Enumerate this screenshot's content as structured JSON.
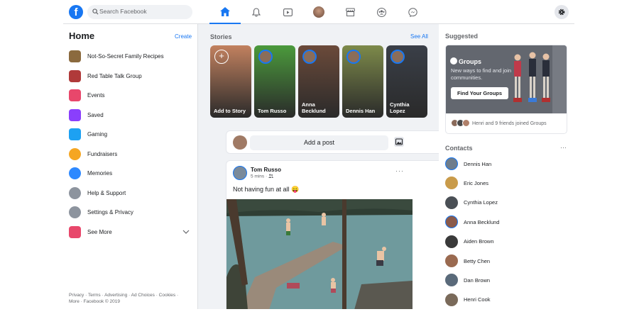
{
  "search": {
    "placeholder": "Search Facebook"
  },
  "nav": [
    "home-icon",
    "bell-icon",
    "video-icon",
    "profile-avatar",
    "marketplace-icon",
    "groups-icon",
    "messenger-icon"
  ],
  "left": {
    "title": "Home",
    "create": "Create",
    "items": [
      {
        "label": "Not-So-Secret Family Recipes",
        "icon": "group-photo-icon",
        "color": "#8b6a3e"
      },
      {
        "label": "Red Table Talk Group",
        "icon": "group-photo-icon",
        "color": "#b03a3a"
      },
      {
        "label": "Events",
        "icon": "calendar-icon",
        "color": "#e8476b"
      },
      {
        "label": "Saved",
        "icon": "bookmark-icon",
        "color": "#8a3ffc"
      },
      {
        "label": "Gaming",
        "icon": "gaming-icon",
        "color": "#1da1f2"
      },
      {
        "label": "Fundraisers",
        "icon": "heart-icon",
        "color": "#f5a623"
      },
      {
        "label": "Memories",
        "icon": "clock-icon",
        "color": "#2e89ff"
      },
      {
        "label": "Help & Support",
        "icon": "question-icon",
        "color": "#8d949e"
      },
      {
        "label": "Settings & Privacy",
        "icon": "gear-icon",
        "color": "#8d949e"
      },
      {
        "label": "See More",
        "icon": "apps-icon",
        "color": "#e8476b"
      }
    ],
    "footer": "Privacy · Terms · Advertising · Ad Choices · Cookies · More · Facebook © 2019"
  },
  "stories": {
    "title": "Stories",
    "see_all": "See All",
    "items": [
      {
        "name": "Add to Story",
        "color": "#c2815f"
      },
      {
        "name": "Tom Russo",
        "color": "#4b9a3c"
      },
      {
        "name": "Anna Becklund",
        "color": "#6b4a3a"
      },
      {
        "name": "Dennis Han",
        "color": "#7d8a4a"
      },
      {
        "name": "Cynthia Lopez",
        "color": "#3a3f48"
      }
    ]
  },
  "composer": {
    "label": "Add a post"
  },
  "post": {
    "author": "Tom Russo",
    "time": "5 mins · ",
    "text": "Not having fun at all 😛",
    "more": "···"
  },
  "suggested": {
    "title": "Suggested",
    "group_title": "Groups",
    "desc": "New ways to find and join communities.",
    "button": "Find Your Groups",
    "footer": "Henri and 9 friends joined Groups"
  },
  "contacts": {
    "title": "Contacts",
    "more": "···",
    "items": [
      {
        "name": "Dennis Han",
        "color": "#6f7d8b",
        "ring": true
      },
      {
        "name": "Eric Jones",
        "color": "#c99b4a",
        "ring": false
      },
      {
        "name": "Cynthia Lopez",
        "color": "#4a4f55",
        "ring": false
      },
      {
        "name": "Anna Becklund",
        "color": "#8a5a4a",
        "ring": true
      },
      {
        "name": "Aiden Brown",
        "color": "#3a3a3a",
        "ring": false
      },
      {
        "name": "Betty Chen",
        "color": "#9a6a50",
        "ring": false
      },
      {
        "name": "Dan Brown",
        "color": "#5a6a7a",
        "ring": false
      },
      {
        "name": "Henri Cook",
        "color": "#7a6a5a",
        "ring": false
      }
    ]
  }
}
